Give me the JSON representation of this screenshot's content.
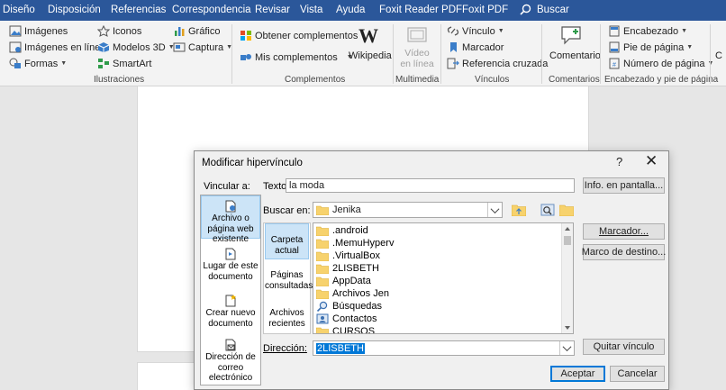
{
  "ribbon_tabs": [
    "Diseño",
    "Disposición",
    "Referencias",
    "Correspondencia",
    "Revisar",
    "Vista",
    "Ayuda",
    "Foxit Reader PDF",
    "Foxit PDF",
    "Buscar"
  ],
  "ribbon": {
    "illustrations": {
      "images": "Imágenes",
      "online_images": "Imágenes en línea",
      "shapes": "Formas",
      "icons": "Iconos",
      "models3d": "Modelos 3D",
      "smartart": "SmartArt",
      "chart": "Gráfico",
      "screenshot": "Captura",
      "group": "Ilustraciones"
    },
    "addins": {
      "get": "Obtener complementos",
      "mine": "Mis complementos",
      "wikipedia": "Wikipedia",
      "group": "Complementos"
    },
    "multimedia": {
      "video_line1": "Vídeo",
      "video_line2": "en línea",
      "group": "Multimedia"
    },
    "links": {
      "link": "Vínculo",
      "bookmark": "Marcador",
      "crossref": "Referencia cruzada",
      "group": "Vínculos"
    },
    "comments": {
      "comment": "Comentario",
      "group": "Comentarios"
    },
    "header_footer": {
      "header": "Encabezado",
      "footer": "Pie de página",
      "page_number": "Número de página",
      "group": "Encabezado y pie de página"
    },
    "cut_text": "C"
  },
  "dialog": {
    "title": "Modificar hipervínculo",
    "help": "?",
    "close": "✕",
    "link_to_label": "Vincular a:",
    "link_to": {
      "file_web": [
        "Archivo o",
        "página web",
        "existente"
      ],
      "place": [
        "Lugar de este",
        "documento"
      ],
      "new_doc": [
        "Crear nuevo",
        "documento"
      ],
      "email": [
        "Dirección de",
        "correo",
        "electrónico"
      ]
    },
    "text_label": "Texto:",
    "text_value": "la moda",
    "screentip_button": "Info. en pantalla...",
    "lookin_label": "Buscar en:",
    "lookin_value": "Jenika",
    "locations": {
      "current_folder": [
        "Carpeta",
        "actual"
      ],
      "browsed_pages": [
        "Páginas",
        "consultadas"
      ],
      "recent_files": [
        "Archivos",
        "recientes"
      ]
    },
    "files": [
      ".android",
      ".MemuHyperv",
      ".VirtualBox",
      "2LISBETH",
      "AppData",
      "Archivos Jen",
      "Búsquedas",
      "Contactos",
      "CURSOS"
    ],
    "bookmark_button": "Marcador...",
    "target_frame_button": "Marco de destino...",
    "address_label": "Dirección:",
    "address_value": "2LISBETH",
    "remove_link_button": "Quitar vínculo",
    "ok_button": "Aceptar",
    "cancel_button": "Cancelar"
  },
  "colors": {
    "ribbon_blue": "#2b579a",
    "selection_bg": "#cce4f7",
    "folder_yellow": "#f7d26d",
    "highlight": "#0078d7"
  }
}
